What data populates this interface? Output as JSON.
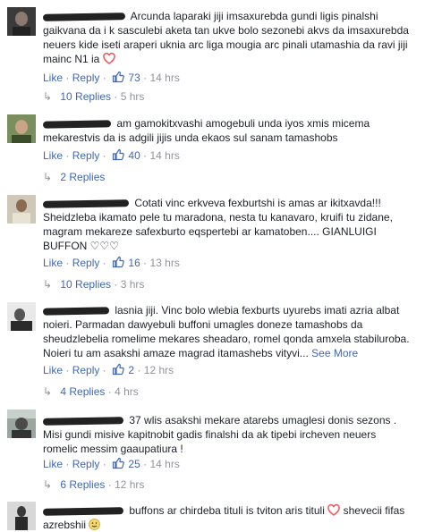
{
  "action_labels": {
    "like": "Like",
    "reply": "Reply",
    "dot": "·"
  },
  "comments": [
    {
      "text": "Arcunda laparaki jiji imsaxurebda gundi ligis pinalshi gaikvana da i k sasculebi aketa tan ukve bolo sezonebi akvs da imsaxurebda neuers kide iseti araperi uknia arc liga mougia arc pinali utamashia da ravi jiji mainc N1 ia",
      "likes": "73",
      "time": "14 hrs",
      "replies_label": "10 Replies",
      "replies_time": "5 hrs"
    },
    {
      "text": "am gamokitxvashi amogebuli unda iyos xmis micema mekarestvis da is adgili jijis unda ekaos sul sanam tamashobs",
      "likes": "40",
      "time": "14 hrs",
      "replies_label": "2 Replies",
      "replies_time": ""
    },
    {
      "text": "Cotati vinc erkveva fexburtshi is amas ar ikitxavda!!! Sheidzleba ikamato pele tu maradona, nesta tu kanavaro, kruifi tu zidane, magram mekareze safexburto eqspertebi ar kamatoben.... GIANLUIGI BUFFON ♡♡♡",
      "likes": "16",
      "time": "13 hrs",
      "replies_label": "10 Replies",
      "replies_time": "3 hrs"
    },
    {
      "text": "lasnia jiji. Vinc bolo wlebia fexburts uyurebs imati azria albat noieri. Parmadan dawyebuli buffoni umagles doneze tamashobs da sheudzlebelia romelime mekares sheadaro, romel qonda amxela stabiluroba. Noieri tu am asakshi amaze magrad itamashebs vityvi...",
      "see_more": "See More",
      "likes": "2",
      "time": "12 hrs",
      "replies_label": "4 Replies",
      "replies_time": "4 hrs"
    },
    {
      "text": "37 wlis asakshi mekare atarebs umaglesi donis sezons . Misi gundi misive kapitnobit gadis finalshi da ak tipebi ircheven neuers romelic messim gaaupatiura !",
      "likes": "25",
      "time": "14 hrs",
      "replies_label": "6 Replies",
      "replies_time": "12 hrs"
    },
    {
      "text": "buffons ar chirdeba tituli is tviton aris tituli",
      "text2": "shevecii fifas azrebshii",
      "likes": "",
      "time": "",
      "replies_label": "",
      "replies_time": ""
    }
  ],
  "colors": {
    "link": "#4267b2",
    "meta": "#90949c",
    "heart": "#f0606a"
  }
}
